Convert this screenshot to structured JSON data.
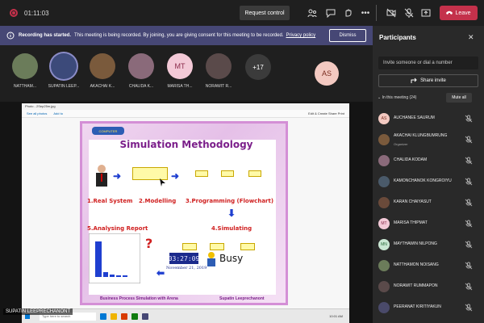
{
  "topbar": {
    "timer": "01:11:03",
    "request_control": "Request control",
    "leave": "Leave"
  },
  "banner": {
    "title": "Recording has started.",
    "text": "This meeting is being recorded. By joining, you are giving consent for this meeting to be recorded.",
    "link": "Privacy policy",
    "dismiss": "Dismiss"
  },
  "strip": {
    "tiles": [
      {
        "name": "NATTHAM...",
        "color": "#6b7c5a"
      },
      {
        "name": "SUPATIN LEEP...",
        "color": "#3c4a7a"
      },
      {
        "name": "AKACHAI K...",
        "color": "#7a5a3c"
      },
      {
        "name": "CHALIDA K...",
        "color": "#8a6a7a"
      },
      {
        "name": "MARISA TH...",
        "initials": "MT",
        "color": "#f3c9d7"
      },
      {
        "name": "NORAWIT R...",
        "color": "#5a4a4a"
      }
    ],
    "more": "+17",
    "self_initials": "AS"
  },
  "shared_screen": {
    "window_title": "Photo - 2Sep25m.jpg",
    "toolbar_left": [
      "See all photos",
      "Add to"
    ],
    "toolbar_right": "Edit & Create  Share  Print",
    "slide": {
      "logo": "COMPUTER",
      "title": "Simulation Methodology",
      "step1": "1.Real System",
      "step2": "2.Modelling",
      "step3": "3.Programming (Flowchart)",
      "step4": "4.Simulating",
      "step5": "5.Analysing Report",
      "clock": "03:27:09",
      "date": "November 21, 2019",
      "busy": "Busy",
      "footer_left": "Business Process Simulation with Arena",
      "footer_right": "Supatin Leeprechanont"
    },
    "taskbar_search": "Type here to search",
    "taskbar_time": "10:01 AM"
  },
  "presenter_label": "SUPATIN LEEPRECHANONT",
  "panel": {
    "title": "Participants",
    "invite_placeholder": "Invite someone or dial a number",
    "share_invite": "Share invite",
    "in_meeting": "In this meeting (24)",
    "mute_all": "Mute all",
    "participants": [
      {
        "initials": "AS",
        "name": "AUCHANEE SAURUM",
        "role": "",
        "bg": "#f3c9c1",
        "fg": "#7a2d20"
      },
      {
        "initials": "",
        "name": "AKACHAI KLUNGBUMRUNG",
        "role": "Organizer",
        "bg": "#7a5a3c",
        "fg": "#fff"
      },
      {
        "initials": "",
        "name": "CHALIDA KODAM",
        "role": "",
        "bg": "#8a6a7a",
        "fg": "#fff"
      },
      {
        "initials": "",
        "name": "KAMONCHANOK KONGROIYU",
        "role": "",
        "bg": "#4a5a6a",
        "fg": "#fff"
      },
      {
        "initials": "",
        "name": "KARAN CHAIYASUT",
        "role": "",
        "bg": "#6a4a3a",
        "fg": "#fff"
      },
      {
        "initials": "MT",
        "name": "MARISA THIPMAT",
        "role": "",
        "bg": "#f3c9d7",
        "fg": "#8a2a4a"
      },
      {
        "initials": "MN",
        "name": "MAYTHAWIN NILPONG",
        "role": "",
        "bg": "#c9e7d3",
        "fg": "#2a6a3a"
      },
      {
        "initials": "",
        "name": "NATTHAMON NOISANG",
        "role": "",
        "bg": "#6b7c5a",
        "fg": "#fff"
      },
      {
        "initials": "",
        "name": "NORAWIT RUMMAPON",
        "role": "",
        "bg": "#5a4a4a",
        "fg": "#fff"
      },
      {
        "initials": "",
        "name": "PEERANAT KIRITIYAKUN",
        "role": "",
        "bg": "#4a4a6a",
        "fg": "#fff"
      }
    ]
  },
  "colors": {
    "accent": "#464775",
    "leave": "#c4314b",
    "slide_title": "#7b1f8a"
  }
}
